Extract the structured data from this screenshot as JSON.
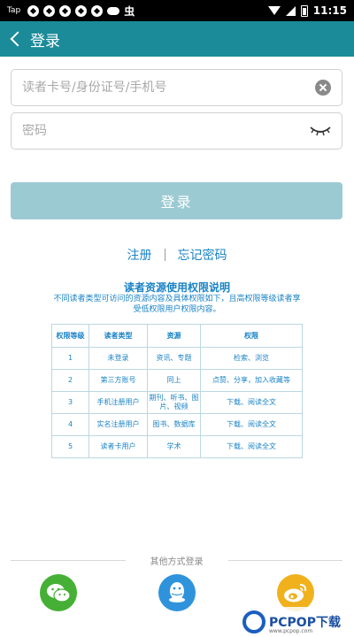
{
  "status_bar": {
    "tap_label": "Tap",
    "bug_glyph": "虫",
    "time": "11:15"
  },
  "app_bar": {
    "title": "登录"
  },
  "form": {
    "username_placeholder": "读者卡号/身份证号/手机号",
    "password_placeholder": "密码",
    "login_label": "登录"
  },
  "links": {
    "register": "注册",
    "forgot": "忘记密码"
  },
  "permissions": {
    "title": "读者资源使用权限说明",
    "description": "不同读者类型可访问的资源内容及具体权限如下，且高权限等级读者享受低权限用户权限内容。",
    "headers": [
      "权限等级",
      "读者类型",
      "资源",
      "权限"
    ],
    "rows": [
      [
        "1",
        "未登录",
        "资讯、专题",
        "检索、浏览"
      ],
      [
        "2",
        "第三方账号",
        "同上",
        "点赞、分享，加入收藏等"
      ],
      [
        "3",
        "手机注册用户",
        "期刊、听书、图片、视频",
        "下载、阅读全文"
      ],
      [
        "4",
        "实名注册用户",
        "图书、数据库",
        "下载、阅读全文"
      ],
      [
        "5",
        "读者卡用户",
        "学术",
        "下载、阅读全文"
      ]
    ]
  },
  "other_login": {
    "label": "其他方式登录",
    "icons": [
      "wechat-icon",
      "qq-icon",
      "weibo-icon"
    ]
  },
  "watermark": {
    "brand": "PCPOP下载",
    "site": "www.pcpop.com"
  },
  "colors": {
    "app_bar": "#1b8b9a",
    "login_button": "#9ccad2",
    "link": "#1a83c6",
    "wechat": "#45b035",
    "qq": "#2f93dc",
    "weibo": "#f0b11c"
  }
}
